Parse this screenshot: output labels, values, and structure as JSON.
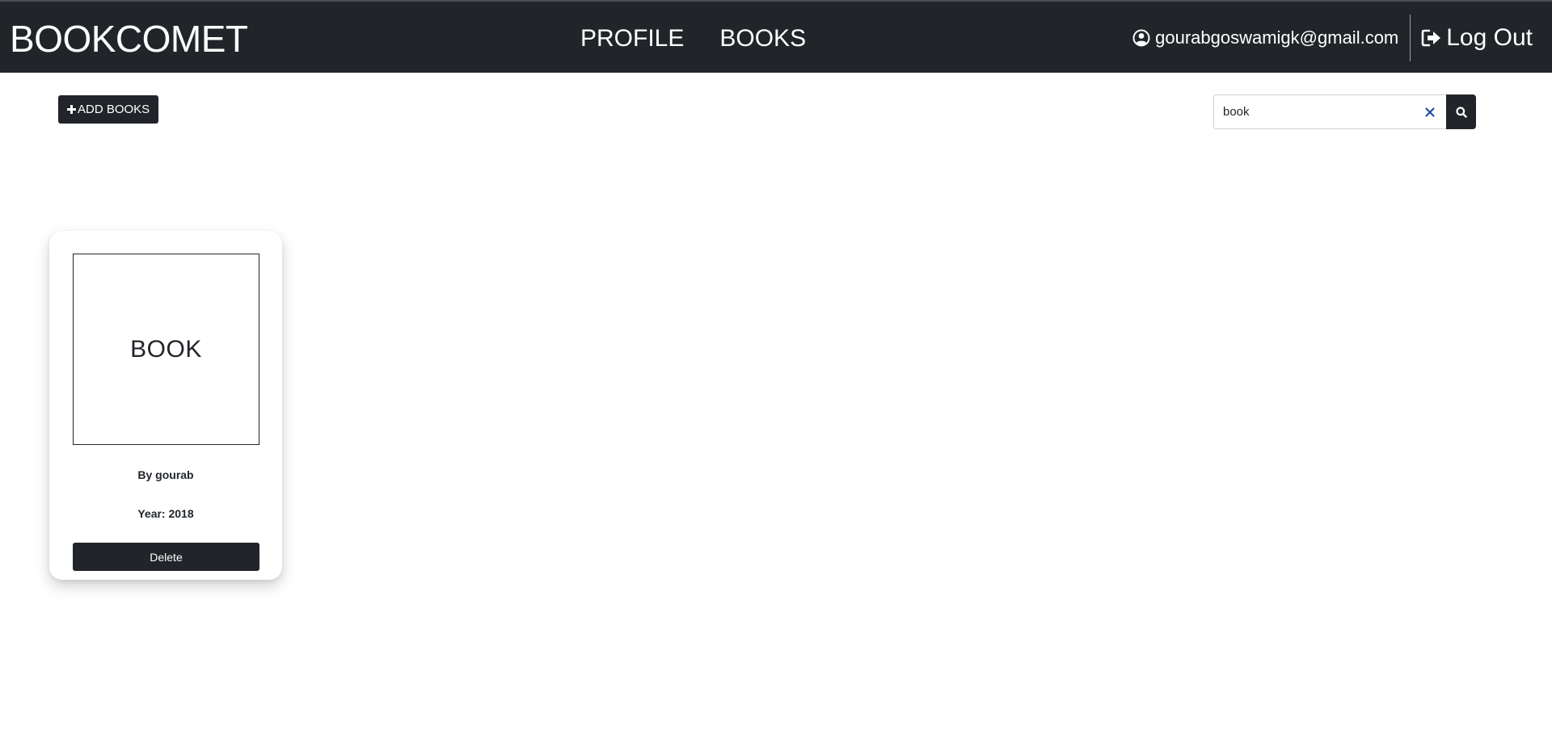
{
  "navbar": {
    "brand": "BOOKCOMET",
    "links": [
      "PROFILE",
      "BOOKS"
    ],
    "user_email": "gourabgoswamigk@gmail.com",
    "logout_label": "Log Out",
    "icons": {
      "user": "user-circle-icon",
      "logout": "sign-out-icon"
    },
    "background": "#212529"
  },
  "toolbar": {
    "add_books_label": "ADD BOOKS",
    "add_icon": "plus-icon"
  },
  "search": {
    "value": "book",
    "clear_icon": "close-icon",
    "button_icon": "search-icon"
  },
  "books": [
    {
      "cover_text": "BOOK",
      "author": "By gourab",
      "year": "Year: 2018",
      "delete_label": "Delete"
    }
  ]
}
